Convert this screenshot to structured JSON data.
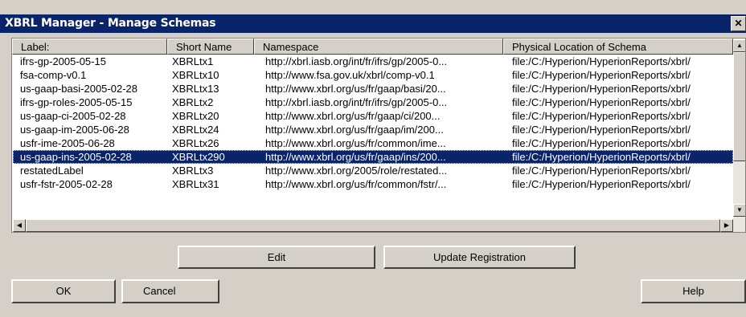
{
  "window": {
    "title": "XBRL Manager - Manage Schemas",
    "close_glyph": "✕"
  },
  "columns": [
    "Label:",
    "Short Name",
    "Namespace",
    "Physical Location of Schema"
  ],
  "rows": [
    [
      "ifrs-gp-2005-05-15",
      "XBRLtx1",
      "http://xbrl.iasb.org/int/fr/ifrs/gp/2005-0...",
      "file:/C:/Hyperion/HyperionReports/xbrl/"
    ],
    [
      "fsa-comp-v0.1",
      "XBRLtx10",
      "http://www.fsa.gov.uk/xbrl/comp-v0.1",
      "file:/C:/Hyperion/HyperionReports/xbrl/"
    ],
    [
      "us-gaap-basi-2005-02-28",
      "XBRLtx13",
      "http://www.xbrl.org/us/fr/gaap/basi/20...",
      "file:/C:/Hyperion/HyperionReports/xbrl/"
    ],
    [
      "ifrs-gp-roles-2005-05-15",
      "XBRLtx2",
      "http://xbrl.iasb.org/int/fr/ifrs/gp/2005-0...",
      "file:/C:/Hyperion/HyperionReports/xbrl/"
    ],
    [
      "us-gaap-ci-2005-02-28",
      "XBRLtx20",
      "http://www.xbrl.org/us/fr/gaap/ci/200...",
      "file:/C:/Hyperion/HyperionReports/xbrl/"
    ],
    [
      "us-gaap-im-2005-06-28",
      "XBRLtx24",
      "http://www.xbrl.org/us/fr/gaap/im/200...",
      "file:/C:/Hyperion/HyperionReports/xbrl/"
    ],
    [
      "usfr-ime-2005-06-28",
      "XBRLtx26",
      "http://www.xbrl.org/us/fr/common/ime...",
      "file:/C:/Hyperion/HyperionReports/xbrl/"
    ],
    [
      "us-gaap-ins-2005-02-28",
      "XBRLtx290",
      "http://www.xbrl.org/us/fr/gaap/ins/200...",
      "file:/C:/Hyperion/HyperionReports/xbrl/"
    ],
    [
      "restatedLabel",
      "XBRLtx3",
      "http://www.xbrl.org/2005/role/restated...",
      "file:/C:/Hyperion/HyperionReports/xbrl/"
    ],
    [
      "usfr-fstr-2005-02-28",
      "XBRLtx31",
      "http://www.xbrl.org/us/fr/common/fstr/...",
      "file:/C:/Hyperion/HyperionReports/xbrl/"
    ]
  ],
  "selected_row": "us-gaap-ins-2005-02-28",
  "scrollbar_glyphs": {
    "up": "▲",
    "down": "▼",
    "left": "◀",
    "right": "▶"
  },
  "buttons": {
    "edit": "Edit",
    "update_registration": "Update Registration",
    "ok": "OK",
    "cancel": "Cancel",
    "help": "Help"
  },
  "colors": {
    "title_bar": "#0a246a",
    "selection": "#0a246a",
    "dialog_face": "#d4d0c8"
  }
}
